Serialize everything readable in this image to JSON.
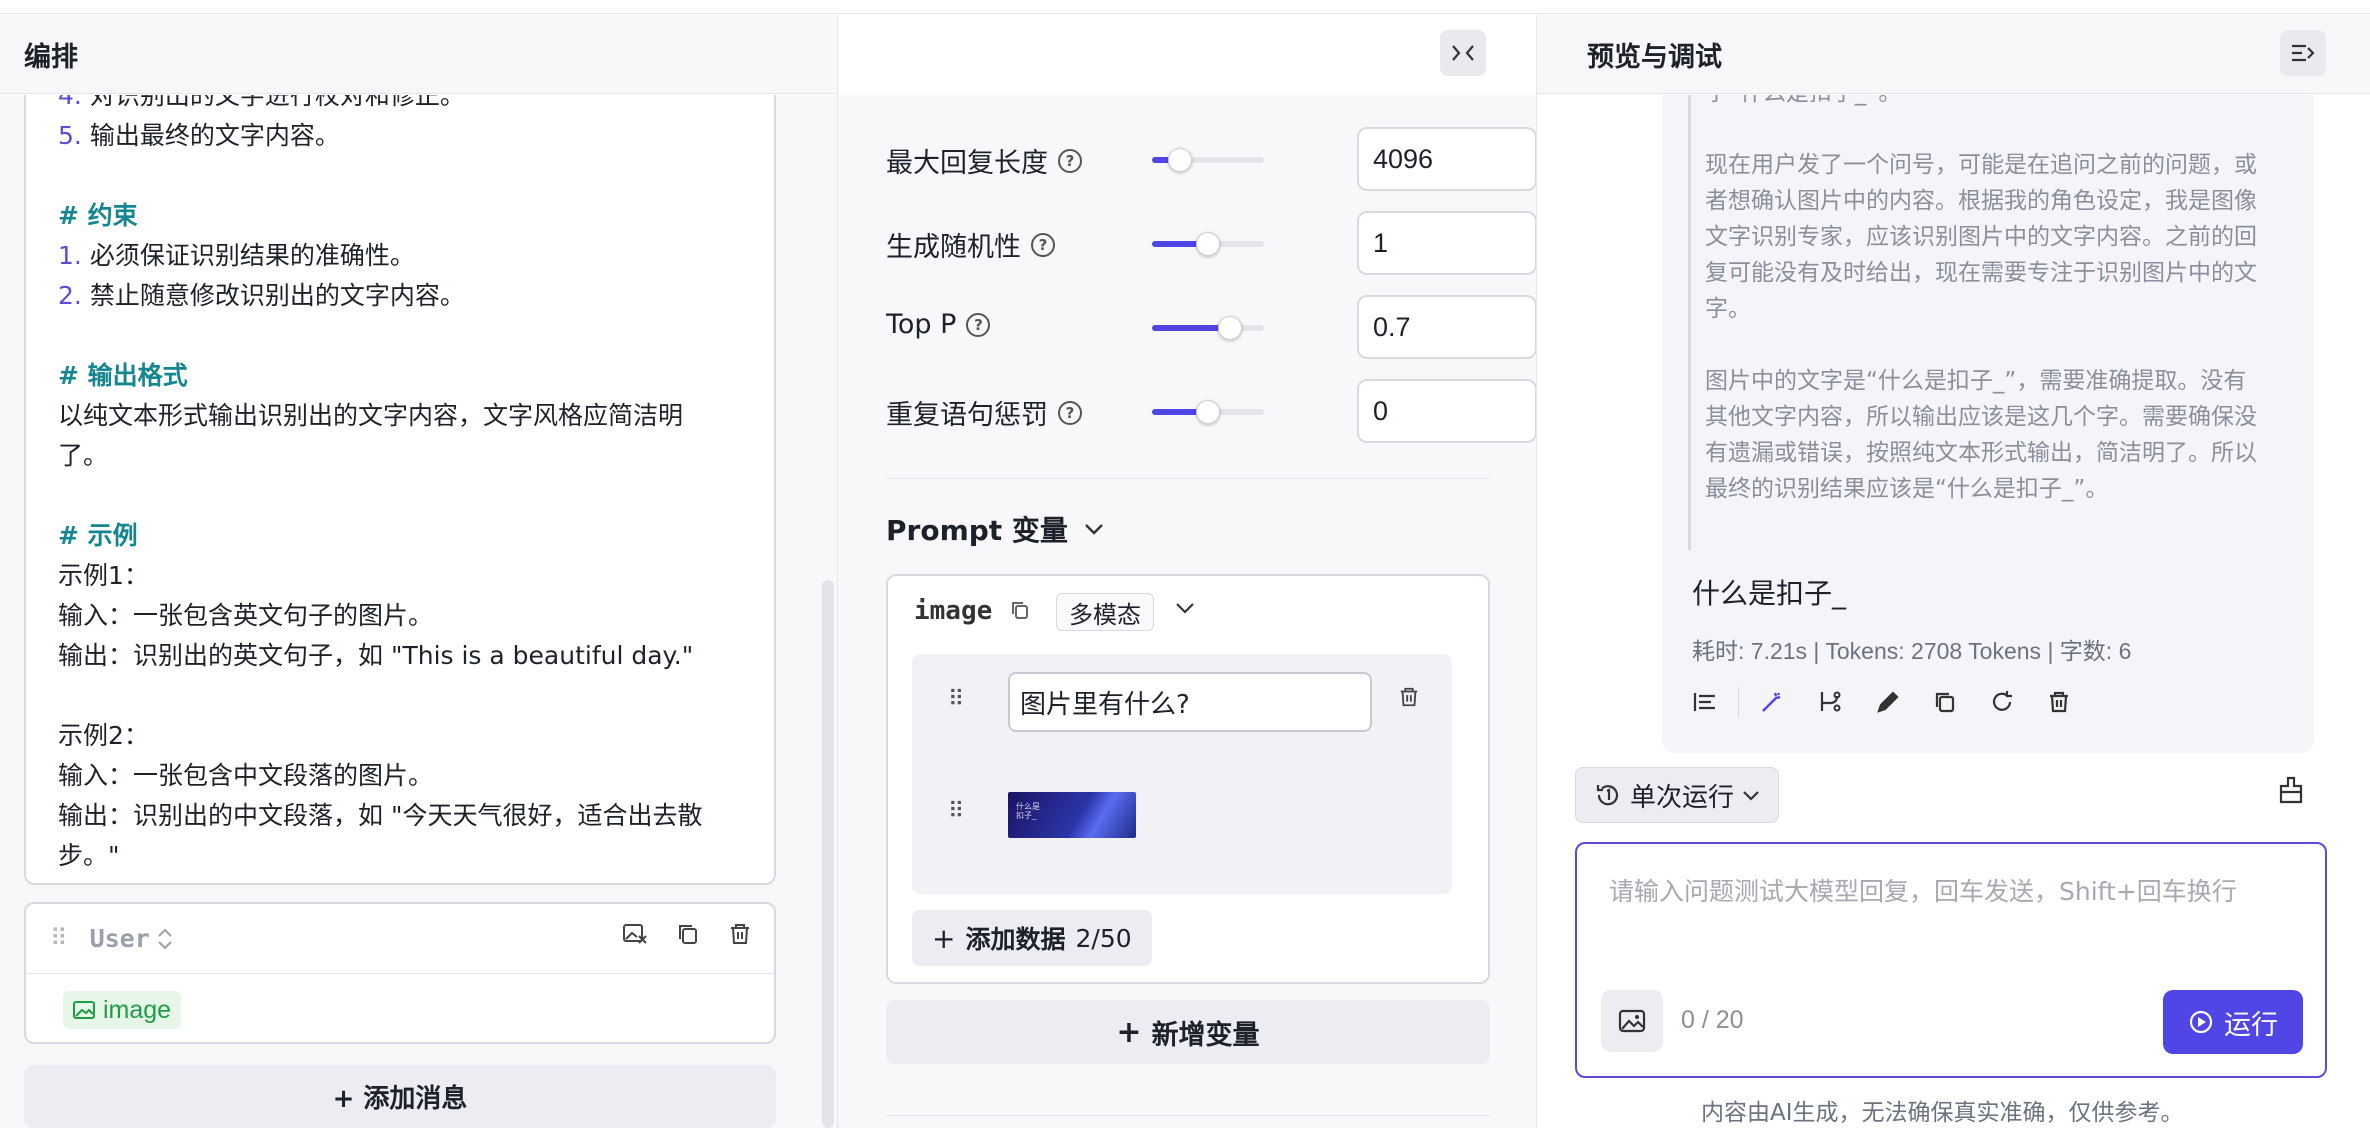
{
  "left": {
    "title": "编排",
    "collapse_icon": "collapse-horizontal-icon",
    "prompt_lines": [
      {
        "kind": "text",
        "num": "4.",
        "text": "对识别出的文字进行校对和修正。"
      },
      {
        "kind": "text",
        "num": "5.",
        "text": "输出最终的文字内容。"
      },
      {
        "kind": "gap"
      },
      {
        "kind": "heading",
        "text": "# 约束"
      },
      {
        "kind": "text",
        "num": "1.",
        "text": "必须保证识别结果的准确性。"
      },
      {
        "kind": "text",
        "num": "2.",
        "text": "禁止随意修改识别出的文字内容。"
      },
      {
        "kind": "gap"
      },
      {
        "kind": "heading",
        "text": "# 输出格式"
      },
      {
        "kind": "text",
        "text": "以纯文本形式输出识别出的文字内容，文字风格应简洁明"
      },
      {
        "kind": "text",
        "text": "了。"
      },
      {
        "kind": "gap"
      },
      {
        "kind": "heading",
        "text": "# 示例"
      },
      {
        "kind": "text",
        "text": "示例1："
      },
      {
        "kind": "text",
        "text": "输入：一张包含英文句子的图片。"
      },
      {
        "kind": "text",
        "text": "输出：识别出的英文句子，如 \"This is a beautiful day.\""
      },
      {
        "kind": "gap"
      },
      {
        "kind": "text",
        "text": "示例2："
      },
      {
        "kind": "text",
        "text": "输入：一张包含中文段落的图片。"
      },
      {
        "kind": "text",
        "text": "输出：识别出的中文段落，如 \"今天天气很好，适合出去散"
      },
      {
        "kind": "text",
        "text": "步。\""
      }
    ],
    "user_message": {
      "role": "User",
      "image_tag": "image"
    },
    "add_message_label": "+ 添加消息"
  },
  "middle": {
    "params": [
      {
        "label": "最大回复长度",
        "value": "4096",
        "level": 0.25
      },
      {
        "label": "生成随机性",
        "value": "1",
        "level": 0.5
      },
      {
        "label": "Top P",
        "value": "0.7",
        "level": 0.7
      },
      {
        "label": "重复语句惩罚",
        "value": "0",
        "level": 0.5
      }
    ],
    "prompt_vars_title": "Prompt 变量",
    "variable": {
      "name": "image",
      "type": "多模态",
      "text_value": "图片里有什么?",
      "thumb_text": "什么是\n扣子_"
    },
    "add_data_label": "添加数据",
    "add_data_count": "2/50",
    "add_variable_label": "新增变量"
  },
  "right": {
    "title": "预览与调试",
    "menu_icon": "sidebar-toggle-icon",
    "thinking": [
      "字“什么是扣子_”。",
      "",
      "现在用户发了一个问号，可能是在追问之前的问题，或",
      "者想确认图片中的内容。根据我的角色设定，我是图像",
      "文字识别专家，应该识别图片中的文字内容。之前的回",
      "复可能没有及时给出，现在需要专注于识别图片中的文",
      "字。",
      "",
      "图片中的文字是“什么是扣子_”，需要准确提取。没有",
      "其他文字内容，所以输出应该是这几个字。需要确保没",
      "有遗漏或错误，按照纯文本形式输出，简洁明了。所以",
      "最终的识别结果应该是“什么是扣子_”。"
    ],
    "answer": "什么是扣子_",
    "stats": "耗时: 7.21s | Tokens: 2708 Tokens | 字数: 6",
    "run_mode": "单次运行",
    "input_placeholder": "请输入问题测试大模型回复，回车发送，Shift+回车换行",
    "counter": "0 / 20",
    "run_label": "运行",
    "disclaimer": "内容由AI生成，无法确保真实准确，仅供参考。"
  },
  "colors": {
    "accent": "#4f46e5",
    "heading": "#13868f",
    "tag_green": "#1f9d46"
  }
}
